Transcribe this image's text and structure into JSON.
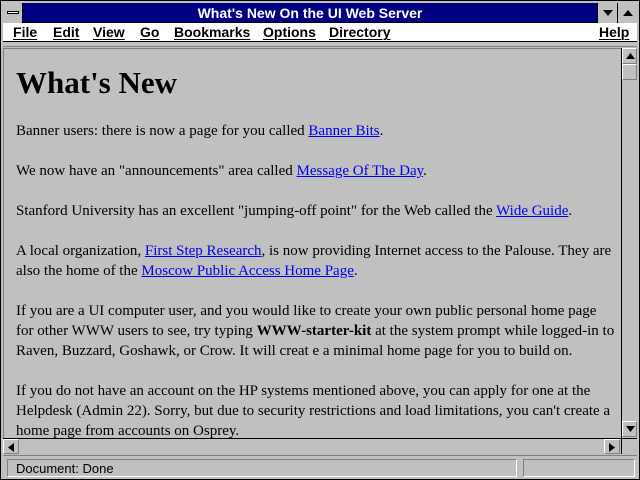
{
  "window": {
    "title": "What's New On the UI Web Server"
  },
  "menubar": {
    "items": [
      "File",
      "Edit",
      "View",
      "Go",
      "Bookmarks",
      "Options",
      "Directory",
      "Help"
    ]
  },
  "content": {
    "heading": "What's New",
    "p1": {
      "before": "Banner users: there is now a page for you called ",
      "link": "Banner Bits",
      "after": "."
    },
    "p2": {
      "before": "We now have an \"announcements\" area called ",
      "link": "Message Of The Day",
      "after": "."
    },
    "p3": {
      "before": "Stanford University has an excellent \"jumping-off point\" for the Web called the ",
      "link": "Wide Guide",
      "after": "."
    },
    "p4": {
      "before": "A local organization, ",
      "link1": "First Step Research",
      "middle": ", is now providing Internet access to the Palouse. They are also the home of the ",
      "link2": "Moscow Public Access Home Page",
      "after": "."
    },
    "p5": {
      "before": "If you are a UI computer user, and you would like to create your own public personal home page for other WWW users to see, try typing ",
      "bold": "WWW-starter-kit",
      "after": " at the system prompt while logged-in to Raven, Buzzard, Goshawk, or Crow. It will creat e a minimal home page for you to build on."
    },
    "p6": {
      "text": "If you do not have an account on the HP systems mentioned above, you can apply for one at the Helpdesk (Admin 22). Sorry, but due to security restrictions and load limitations, you can't create a home page from accounts on Osprey."
    }
  },
  "statusbar": {
    "text": "Document: Done"
  },
  "colors": {
    "titlebar": "#000080",
    "background": "#c0c0c0",
    "link": "#0000ee"
  },
  "icons": [
    "system-menu-icon",
    "minimize-icon",
    "maximize-icon",
    "scroll-up-icon",
    "scroll-down-icon",
    "scroll-left-icon",
    "scroll-right-icon"
  ]
}
